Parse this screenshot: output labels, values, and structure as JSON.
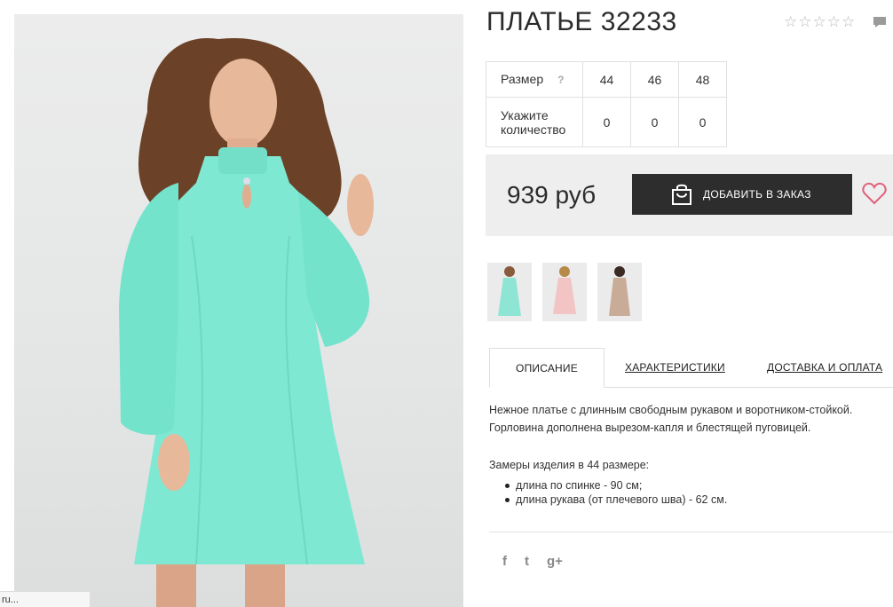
{
  "product": {
    "title": "ПЛАТЬЕ 32233",
    "rating_stars": 5,
    "price": "939 руб",
    "order_button_label": "ДОБАВИТЬ В ЗАКАЗ"
  },
  "size_table": {
    "size_label": "Размер",
    "help_mark": "?",
    "sizes": [
      "44",
      "46",
      "48"
    ],
    "quantity_label": "Укажите количество",
    "quantities": [
      "0",
      "0",
      "0"
    ]
  },
  "tabs": [
    {
      "label": "ОПИСАНИЕ",
      "active": true
    },
    {
      "label": "ХАРАКТЕРИСТИКИ",
      "active": false
    },
    {
      "label": "ДОСТАВКА И ОПЛАТА",
      "active": false
    }
  ],
  "description": {
    "text": "Нежное платье с длинным свободным рукавом и воротником-стойкой. Горловина дополнена вырезом-капля и блестящей пуговицей.",
    "measures_title": "Замеры изделия в 44 размере:",
    "measures": [
      "длина по спинке - 90 см;",
      "длина рукава (от плечевого шва) - 62 см."
    ]
  },
  "social": {
    "facebook": "f",
    "twitter": "t",
    "googleplus": "g+"
  },
  "status_bar": {
    "url_fragment": "ru..."
  },
  "colors": {
    "dress_main": "#7fe8d2",
    "accent_dark": "#2d2d2d",
    "heart": "#e0607a",
    "price_box_bg": "#eeeeee"
  },
  "thumbnails": [
    {
      "icon": "mint-dress-thumb",
      "color": "#8ee5d3"
    },
    {
      "icon": "pink-dress-thumb",
      "color": "#f2c4c4"
    },
    {
      "icon": "beige-dress-thumb",
      "color": "#c9ac98"
    }
  ]
}
